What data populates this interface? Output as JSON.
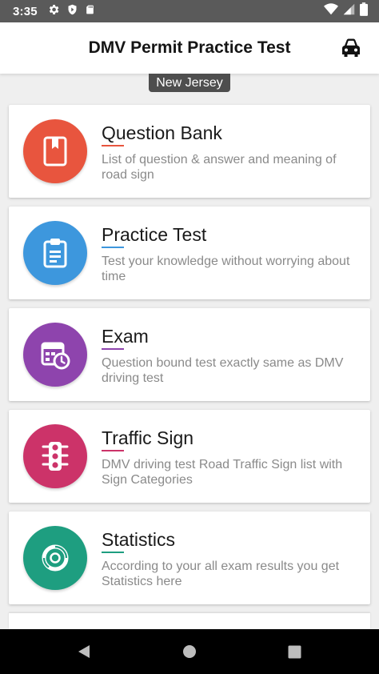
{
  "status_bar": {
    "time": "3:35",
    "icons": [
      "settings-icon",
      "shield-icon",
      "sd-card-icon",
      "wifi-icon",
      "signal-icon",
      "battery-icon"
    ]
  },
  "app_bar": {
    "title": "DMV Permit Practice Test",
    "action_icon": "car-icon"
  },
  "state": {
    "name": "New Jersey"
  },
  "menu": {
    "items": [
      {
        "title": "Question Bank",
        "description": "List of question & answer and meaning of road sign",
        "icon": "bookmark-book-icon",
        "color": "#e8553e"
      },
      {
        "title": "Practice Test",
        "description": "Test your knowledge without worrying about time",
        "icon": "clipboard-icon",
        "color": "#3d97dd"
      },
      {
        "title": "Exam",
        "description": "Question bound test exactly same as DMV driving test",
        "icon": "calendar-clock-icon",
        "color": "#8e44ad"
      },
      {
        "title": "Traffic Sign",
        "description": "DMV driving test Road Traffic Sign list with Sign Categories",
        "icon": "traffic-light-icon",
        "color": "#cc3369"
      },
      {
        "title": "Statistics",
        "description": "According to your all exam results you get Statistics here",
        "icon": "chart-donut-icon",
        "color": "#1e9e80"
      }
    ]
  },
  "nav_bar": {
    "buttons": [
      "back-icon",
      "home-icon",
      "recents-icon"
    ]
  }
}
